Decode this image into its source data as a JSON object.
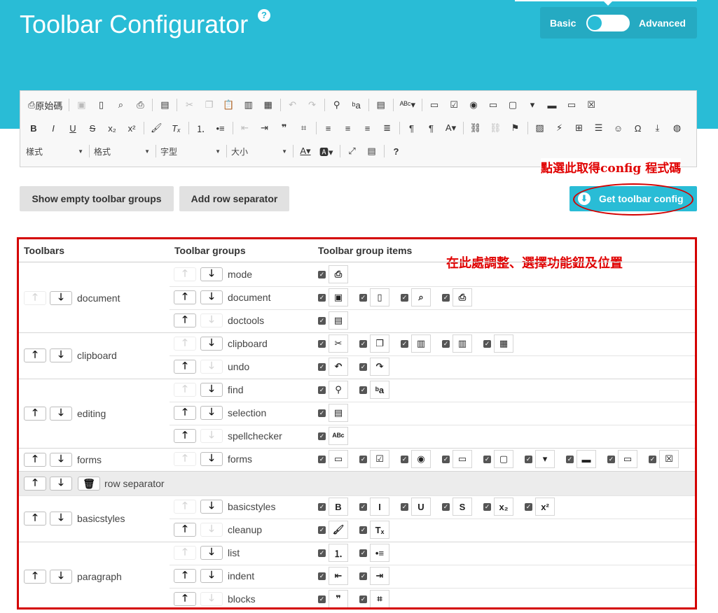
{
  "header": {
    "title": "Toolbar Configurator",
    "help": "?",
    "mode_basic": "Basic",
    "mode_advanced": "Advanced"
  },
  "editor": {
    "row1": [
      "原始碼"
    ],
    "combos": [
      "樣式",
      "格式",
      "字型",
      "大小"
    ]
  },
  "buttons": {
    "show_empty": "Show empty toolbar groups",
    "add_separator": "Add row separator",
    "get_config": "Get toolbar config"
  },
  "annotations": {
    "get_config_note": "點選此取得config 程式碼",
    "adjust_note": "在此處調整、選擇功能鈕及位置"
  },
  "table": {
    "headers": [
      "Toolbars",
      "Toolbar groups",
      "Toolbar group items"
    ],
    "toolbars": [
      {
        "name": "document",
        "groups": [
          {
            "name": "mode",
            "items": [
              "source"
            ]
          },
          {
            "name": "document",
            "items": [
              "save",
              "newpage",
              "preview",
              "print"
            ]
          },
          {
            "name": "doctools",
            "items": [
              "templates"
            ]
          }
        ]
      },
      {
        "name": "clipboard",
        "groups": [
          {
            "name": "clipboard",
            "items": [
              "cut",
              "copy",
              "paste",
              "pastetext",
              "pastefromword"
            ]
          },
          {
            "name": "undo",
            "items": [
              "undo",
              "redo"
            ]
          }
        ]
      },
      {
        "name": "editing",
        "groups": [
          {
            "name": "find",
            "items": [
              "find",
              "replace"
            ]
          },
          {
            "name": "selection",
            "items": [
              "selectall"
            ]
          },
          {
            "name": "spellchecker",
            "items": [
              "scayt"
            ]
          }
        ]
      },
      {
        "name": "forms",
        "groups": [
          {
            "name": "forms",
            "items": [
              "form",
              "checkbox",
              "radio",
              "textfield",
              "textarea",
              "select",
              "button",
              "imagebutton",
              "hiddenfield"
            ]
          }
        ]
      },
      {
        "name": "row separator",
        "groups": []
      },
      {
        "name": "basicstyles",
        "groups": [
          {
            "name": "basicstyles",
            "items": [
              "bold",
              "italic",
              "underline",
              "strike",
              "subscript",
              "superscript"
            ]
          },
          {
            "name": "cleanup",
            "items": [
              "brush",
              "removeformat"
            ]
          }
        ]
      },
      {
        "name": "paragraph",
        "groups": [
          {
            "name": "list",
            "items": [
              "numberedlist",
              "bulletedlist"
            ]
          },
          {
            "name": "indent",
            "items": [
              "outdent",
              "indent"
            ]
          },
          {
            "name": "blocks",
            "items": [
              "blockquote",
              "creatediv"
            ]
          }
        ]
      }
    ]
  },
  "colors": {
    "accent": "#29bcd6",
    "annotation_red": "#d40000"
  }
}
